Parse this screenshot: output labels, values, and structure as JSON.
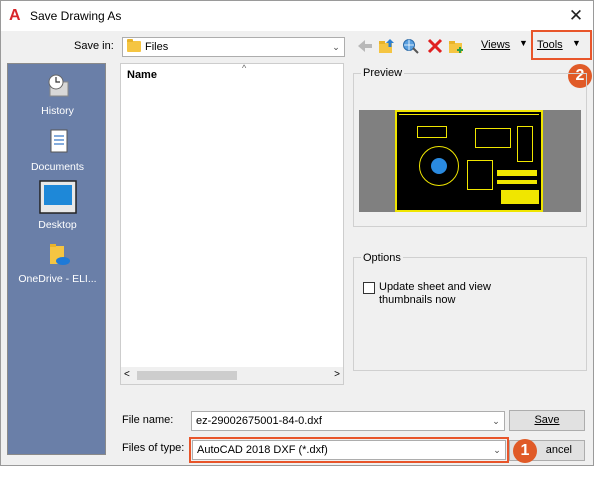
{
  "window": {
    "title": "Save Drawing As"
  },
  "save_in": {
    "label": "Save in:",
    "value": "Files"
  },
  "toolbar": {
    "views_label": "Views",
    "tools_label": "Tools"
  },
  "places": [
    {
      "label": "History"
    },
    {
      "label": "Documents"
    },
    {
      "label": "Desktop"
    },
    {
      "label": "OneDrive - ELI..."
    }
  ],
  "file_list": {
    "column_name": "Name"
  },
  "preview": {
    "label": "Preview"
  },
  "options": {
    "label": "Options",
    "checkbox_label": "Update sheet and view thumbnails now"
  },
  "file_name": {
    "label": "File name:",
    "value": "ez-29002675001-84-0.dxf"
  },
  "file_type": {
    "label": "Files of type:",
    "value": "AutoCAD 2018 DXF (*.dxf)"
  },
  "buttons": {
    "save": "Save",
    "cancel": "ancel"
  },
  "annotations": {
    "badge_1": "1",
    "badge_2": "2"
  },
  "colors": {
    "highlight": "#e8552a",
    "places_bg": "#6a7fa8"
  }
}
